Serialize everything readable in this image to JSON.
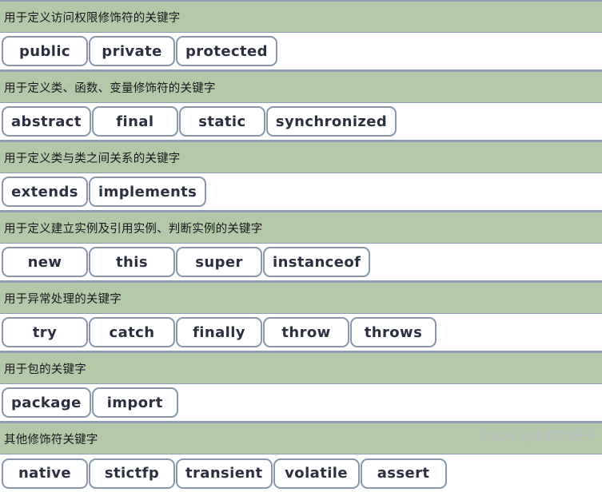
{
  "colors": {
    "header_bg": "#b3c9a8",
    "rule": "#8d9bb0",
    "chip_border": "#8796ab",
    "chip_bg": "#ffffff",
    "chip_text": "#2b3041",
    "header_text": "#16181c",
    "watermark_text": "#b9bdc4"
  },
  "watermark": "CSDN @发疯的橙子",
  "sections": [
    {
      "title": "用于定义访问权限修饰符的关键字",
      "keywords": [
        "public",
        "private",
        "protected"
      ]
    },
    {
      "title": "用于定义类、函数、变量修饰符的关键字",
      "keywords": [
        "abstract",
        "final",
        "static",
        "synchronized"
      ]
    },
    {
      "title": "用于定义类与类之间关系的关键字",
      "keywords": [
        "extends",
        "implements"
      ]
    },
    {
      "title": "用于定义建立实例及引用实例、判断实例的关键字",
      "keywords": [
        "new",
        "this",
        "super",
        "instanceof"
      ]
    },
    {
      "title": "用于异常处理的关键字",
      "keywords": [
        "try",
        "catch",
        "finally",
        "throw",
        "throws"
      ]
    },
    {
      "title": "用于包的关键字",
      "keywords": [
        "package",
        "import"
      ]
    },
    {
      "title": "其他修饰符关键字",
      "keywords": [
        "native",
        "stictfp",
        "transient",
        "volatile",
        "assert"
      ]
    }
  ]
}
